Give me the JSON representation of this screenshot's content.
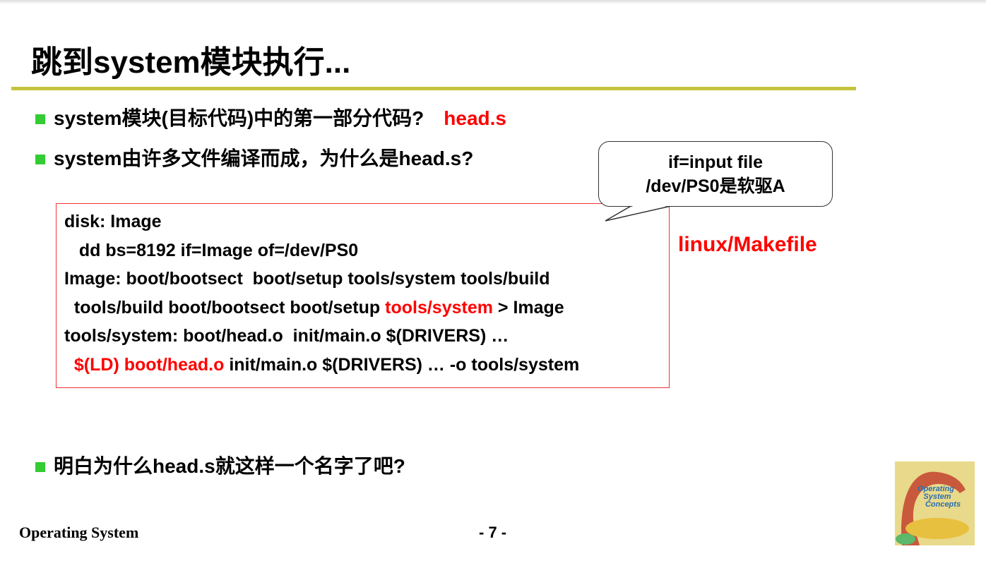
{
  "title": "跳到system模块执行...",
  "bullets": [
    {
      "text": "system模块(目标代码)中的第一部分代码?",
      "highlight": "head.s"
    },
    {
      "text": "system由许多文件编译而成，为什么是head.s?"
    },
    {
      "text": "明白为什么head.s就这样一个名字了吧?"
    }
  ],
  "code": {
    "l1": "disk: Image",
    "l2": "   dd bs=8192 if=Image of=/dev/PS0",
    "l3": "Image: boot/bootsect  boot/setup tools/system tools/build",
    "l4a": "  tools/build boot/bootsect boot/setup ",
    "l4b": "tools/system",
    "l4c": " > Image",
    "l5": "tools/system: boot/head.o  init/main.o $(DRIVERS) …",
    "l6a": "  $(LD) boot/head.o",
    "l6b": " init/main.o $(DRIVERS) … -o tools/system"
  },
  "callout": {
    "line1": "if=input file",
    "line2": "/dev/PS0是软驱A"
  },
  "makefile_label": "linux/Makefile",
  "footer": {
    "left": "Operating System",
    "page": "- 7 -"
  },
  "book_cover_text": "Operating System Concepts",
  "colors": {
    "accent_rule": "#c4c43c",
    "bullet": "#33cc33",
    "highlight": "#ff0000"
  }
}
